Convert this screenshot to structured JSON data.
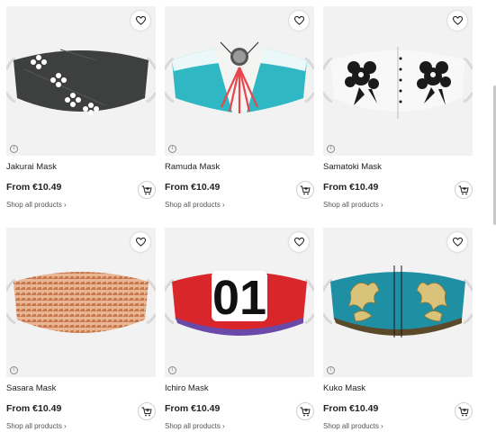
{
  "products": [
    {
      "name": "Jakurai Mask",
      "price": "From €10.49",
      "shop_link": "Shop all products ›",
      "design": "jakurai"
    },
    {
      "name": "Ramuda Mask",
      "price": "From €10.49",
      "shop_link": "Shop all products ›",
      "design": "ramuda"
    },
    {
      "name": "Samatoki Mask",
      "price": "From €10.49",
      "shop_link": "Shop all products ›",
      "design": "samatoki"
    },
    {
      "name": "Sasara Mask",
      "price": "From €10.49",
      "shop_link": "Shop all products ›",
      "design": "sasara"
    },
    {
      "name": "Ichiro Mask",
      "price": "From €10.49",
      "shop_link": "Shop all products ›",
      "design": "ichiro",
      "print_text": "01"
    },
    {
      "name": "Kuko Mask",
      "price": "From €10.49",
      "shop_link": "Shop all products ›",
      "design": "kuko"
    }
  ],
  "icons": {
    "favorite": "heart-outline-icon",
    "cart": "add-to-cart-icon",
    "info": "info-icon"
  },
  "info_glyph": "i",
  "colors": {
    "thumb_bg": "#f2f2f2",
    "jakurai": "#3e3f3f",
    "ramuda": "#2fb8c4",
    "sasara": "#e2a27a",
    "ichiro": "#d8262b",
    "kuko": "#1f8fa3"
  }
}
